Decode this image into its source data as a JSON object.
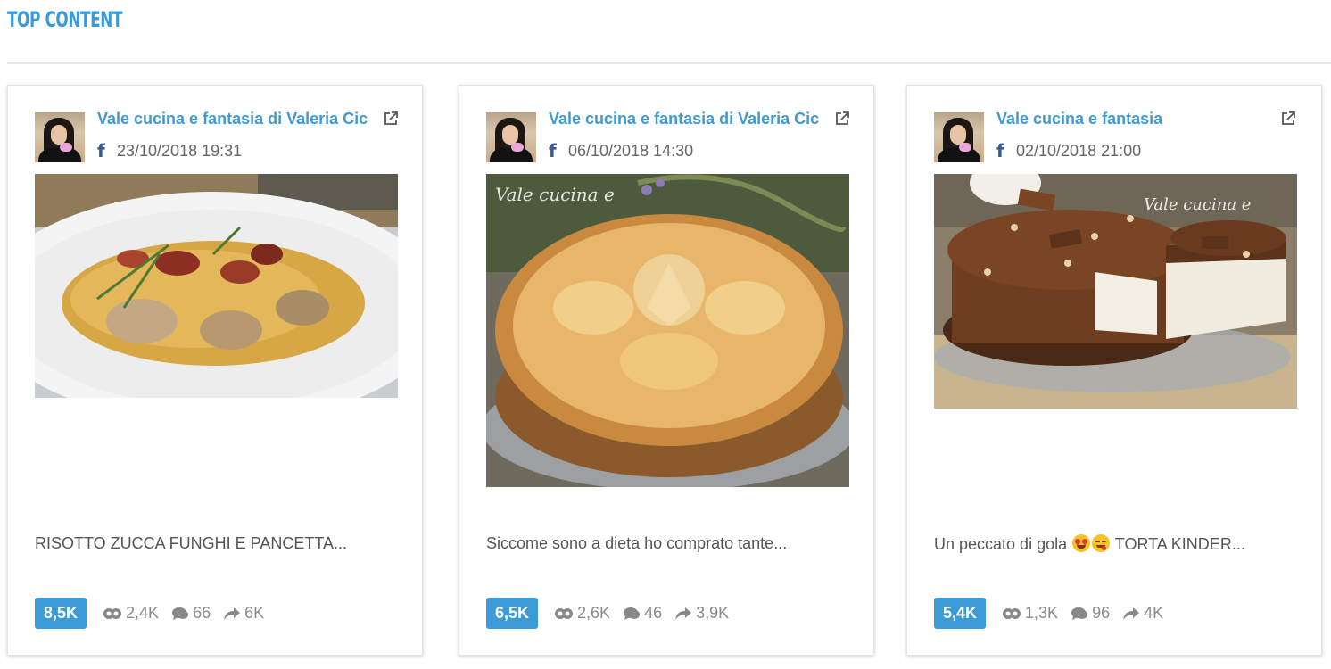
{
  "section": {
    "title": "TOP CONTENT"
  },
  "cards": [
    {
      "page_name": "Vale cucina e fantasia di Valeria Cic",
      "platform_icon": "facebook-icon",
      "date": "23/10/2018 19:31",
      "image": "risotto-photo",
      "text": "RISOTTO ZUCCA FUNGHI E PANCETTA...",
      "text_emojis": [],
      "text_suffix": "",
      "score": "8,5K",
      "impressions": "2,4K",
      "comments": "66",
      "shares": "6K"
    },
    {
      "page_name": "Vale cucina e fantasia di Valeria Cic",
      "platform_icon": "facebook-icon",
      "date": "06/10/2018 14:30",
      "image": "apple-cake-photo",
      "text": "Siccome sono a dieta ho comprato tante...",
      "text_emojis": [],
      "text_suffix": "",
      "score": "6,5K",
      "impressions": "2,6K",
      "comments": "46",
      "shares": "3,9K"
    },
    {
      "page_name": "Vale cucina e fantasia",
      "platform_icon": "facebook-icon",
      "date": "02/10/2018 21:00",
      "image": "chocolate-cake-photo",
      "text": "Un peccato di gola ",
      "text_emojis": [
        "heart-eyes-emoji",
        "yum-emoji"
      ],
      "text_suffix": " TORTA KINDER...",
      "score": "5,4K",
      "impressions": "1,3K",
      "comments": "96",
      "shares": "4K"
    }
  ],
  "colors": {
    "accent": "#3d9ad8",
    "facebook": "#3b5998",
    "muted_text": "#8a8a8a",
    "body_text": "#555555"
  }
}
